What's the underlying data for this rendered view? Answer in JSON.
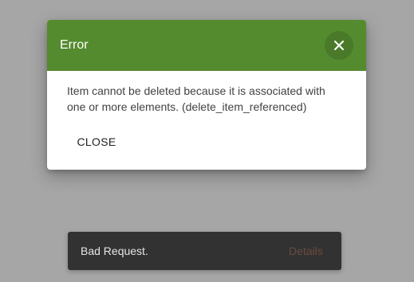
{
  "colors": {
    "backdrop": "#a6a6a6",
    "header": "#558b2f",
    "header_button": "#4a7a29",
    "snackbar": "#323232",
    "snack_action": "#6b4b3f"
  },
  "dialog": {
    "title": "Error",
    "close_icon": "close-icon",
    "message_line1": "Item cannot be deleted because it is associated with",
    "message_line2": "one or more elements. (delete_item_referenced)",
    "close_label": "CLOSE"
  },
  "snackbar": {
    "message": "Bad Request.",
    "action_label": "Details"
  }
}
